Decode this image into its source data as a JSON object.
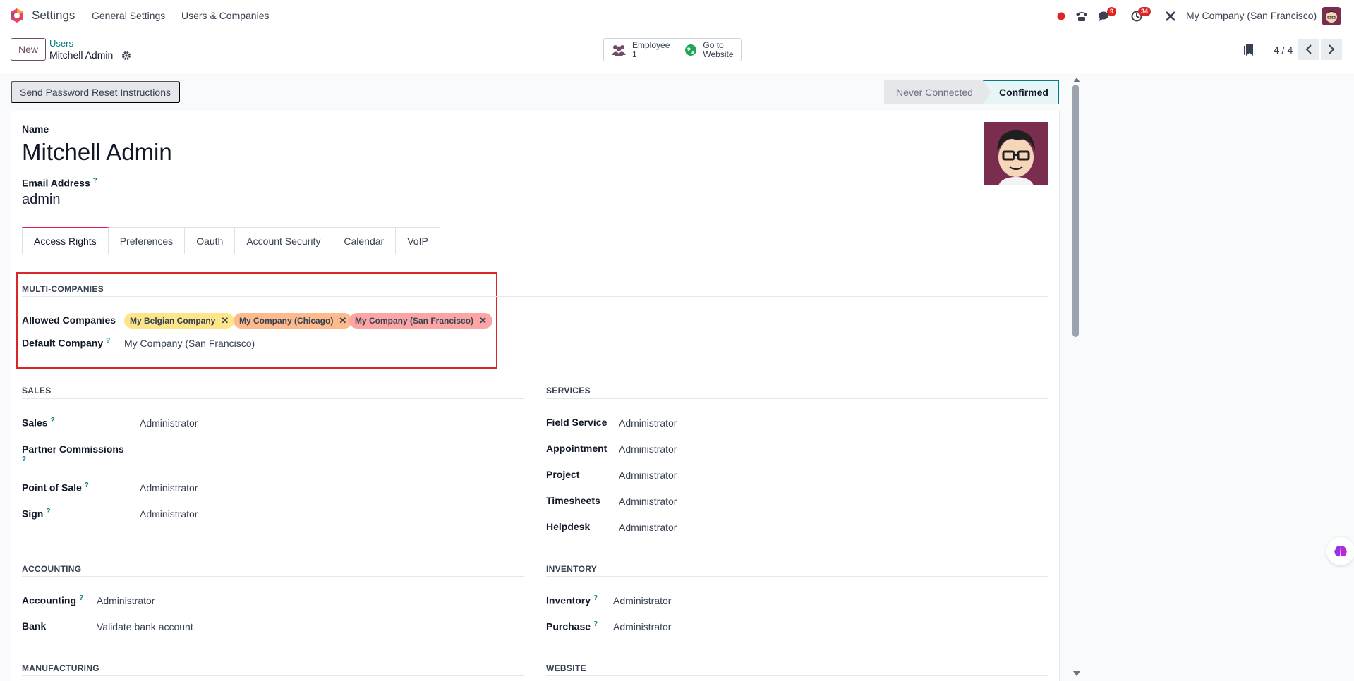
{
  "navbar": {
    "app_title": "Settings",
    "menu": [
      "General Settings",
      "Users & Companies"
    ],
    "badges": {
      "messages": "9",
      "activities": "34"
    },
    "company": "My Company (San Francisco)"
  },
  "control": {
    "new_label": "New",
    "breadcrumb_parent": "Users",
    "breadcrumb_current": "Mitchell Admin",
    "smart_buttons": {
      "employee_label": "Employee",
      "employee_count": "1",
      "website_label_1": "Go to",
      "website_label_2": "Website"
    },
    "pager": "4 / 4"
  },
  "status": {
    "reset_button": "Send Password Reset Instructions",
    "steps": [
      "Never Connected",
      "Confirmed"
    ],
    "active_step": "Confirmed"
  },
  "form": {
    "name_label": "Name",
    "name_value": "Mitchell Admin",
    "email_label": "Email Address",
    "email_value": "admin",
    "tabs": [
      "Access Rights",
      "Preferences",
      "Oauth",
      "Account Security",
      "Calendar",
      "VoIP"
    ],
    "active_tab": "Access Rights",
    "multi_companies": {
      "title": "MULTI-COMPANIES",
      "allowed_label": "Allowed Companies",
      "allowed": [
        {
          "name": "My Belgian Company",
          "color": "#fde68a"
        },
        {
          "name": "My Company (Chicago)",
          "color": "#fdba8c"
        },
        {
          "name": "My Company (San Francisco)",
          "color": "#fca5a5"
        }
      ],
      "default_label": "Default Company",
      "default_value": "My Company (San Francisco)"
    },
    "sales": {
      "title": "SALES",
      "rows": [
        {
          "label": "Sales",
          "value": "Administrator"
        },
        {
          "label": "Partner Commissions",
          "value": ""
        },
        {
          "label": "Point of Sale",
          "value": "Administrator"
        },
        {
          "label": "Sign",
          "value": "Administrator"
        }
      ]
    },
    "services": {
      "title": "SERVICES",
      "rows": [
        {
          "label": "Field Service",
          "value": "Administrator"
        },
        {
          "label": "Appointment",
          "value": "Administrator"
        },
        {
          "label": "Project",
          "value": "Administrator"
        },
        {
          "label": "Timesheets",
          "value": "Administrator"
        },
        {
          "label": "Helpdesk",
          "value": "Administrator"
        }
      ]
    },
    "accounting": {
      "title": "ACCOUNTING",
      "rows": [
        {
          "label": "Accounting",
          "value": "Administrator"
        },
        {
          "label": "Bank",
          "value": "Validate bank account"
        }
      ]
    },
    "inventory": {
      "title": "INVENTORY",
      "rows": [
        {
          "label": "Inventory",
          "value": "Administrator"
        },
        {
          "label": "Purchase",
          "value": "Administrator"
        }
      ]
    },
    "manufacturing_title": "MANUFACTURING",
    "website_title": "WEBSITE"
  },
  "colors": {
    "brand": "#714b67",
    "link": "#017e84",
    "highlight_box": "#dc2626"
  }
}
